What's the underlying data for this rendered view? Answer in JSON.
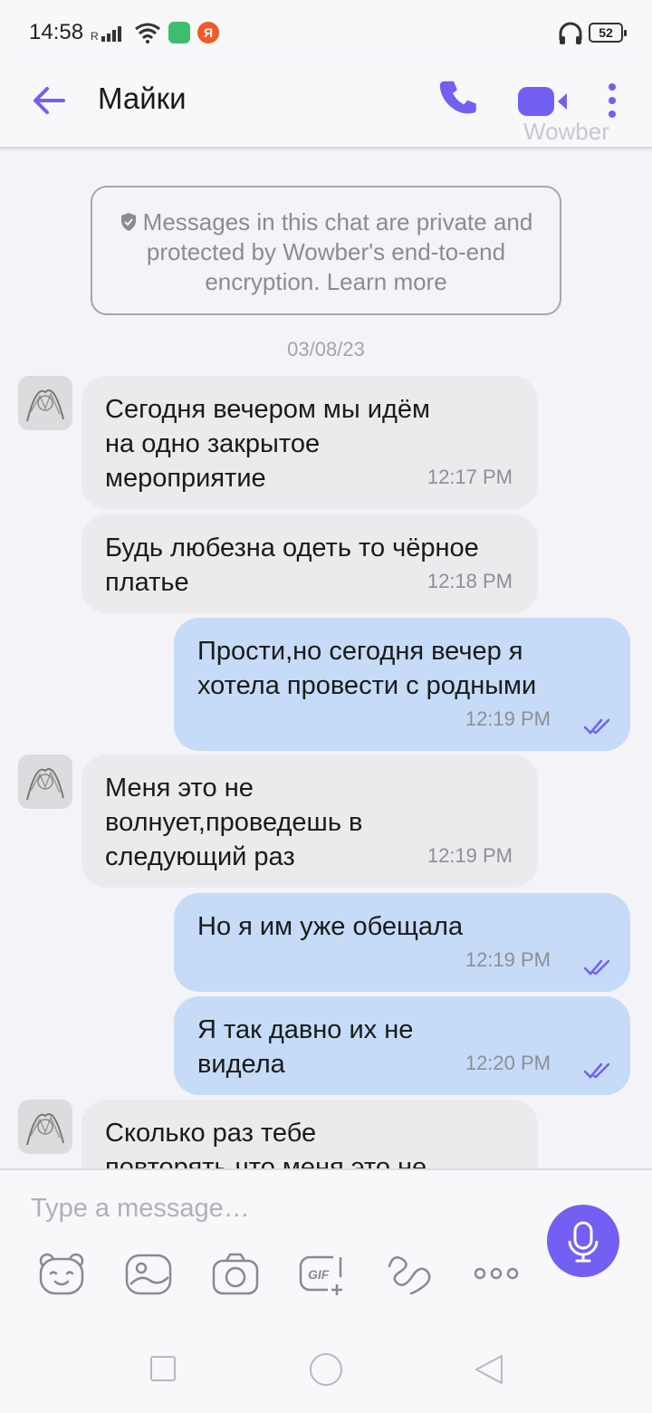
{
  "status_bar": {
    "time": "14:58",
    "battery": "52",
    "app2_glyph": "Я"
  },
  "header": {
    "title": "Майки",
    "watermark": "Wowber",
    "icons": [
      "back-arrow-icon",
      "phone-icon",
      "video-camera-icon",
      "more-vertical-icon"
    ]
  },
  "chat": {
    "e2e_notice": "Messages in this chat are private and protected by Wowber's end-to-end encryption. Learn more",
    "date": "03/08/23",
    "messages": [
      {
        "dir": "in",
        "text": "Сегодня вечером мы идём на одно закрытое мероприятие",
        "time": "12:17 PM"
      },
      {
        "dir": "in",
        "text": "Будь любезна одеть то чёрное платье",
        "time": "12:18 PM"
      },
      {
        "dir": "out",
        "text": "Прости,но сегодня вечер я хотела провести с родными",
        "time": "12:19 PM"
      },
      {
        "dir": "in",
        "text": "Меня это не волнует,проведешь в следующий раз",
        "time": "12:19 PM"
      },
      {
        "dir": "out",
        "text": "Но я им уже обещала",
        "time": "12:19 PM"
      },
      {
        "dir": "out",
        "text": "Я так давно их не видела",
        "time": "12:20 PM"
      },
      {
        "dir": "in",
        "text": "Сколько раз тебе повторять,что меня это не",
        "time": ""
      }
    ]
  },
  "composer": {
    "placeholder": "Type a message…",
    "tools": [
      "sticker-bear-icon",
      "gallery-icon",
      "camera-icon",
      "gif-icon",
      "doodle-icon",
      "more-horizontal-icon"
    ],
    "send_icon": "microphone-icon"
  },
  "colors": {
    "accent": "#7360f2",
    "incoming_bubble": "#ebeaed",
    "outgoing_bubble": "#c5dbf7"
  }
}
